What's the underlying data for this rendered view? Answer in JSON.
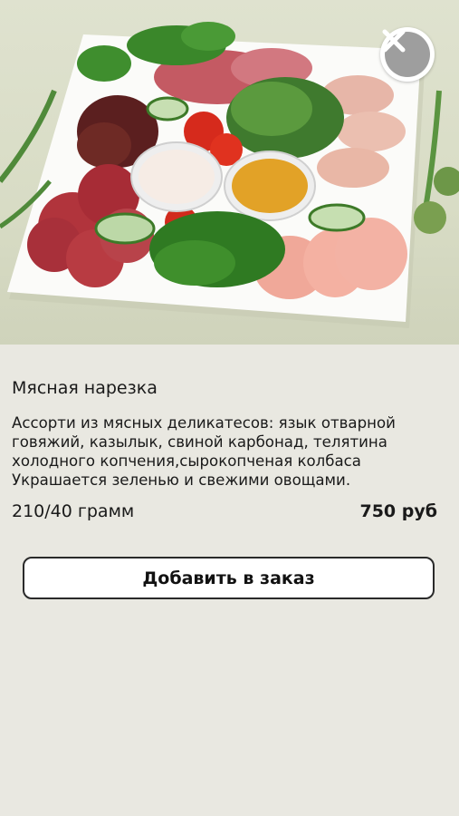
{
  "dish": {
    "title": "Мясная нарезка",
    "description": "Ассорти из мясных деликатесов: язык отварной говяжий, казылык, свиной карбонад, телятина холодного копчения,сырокопченая колбаса\nУкрашается зеленью и свежими овощами.",
    "weight": "210/40 грамм",
    "price": "750 руб"
  },
  "actions": {
    "add_to_order": "Добавить в заказ"
  },
  "icons": {
    "close": "close-icon"
  },
  "colors": {
    "background": "#e9e8e1",
    "close_circle": "#9e9e9e",
    "button_border": "#2a2a2a"
  }
}
